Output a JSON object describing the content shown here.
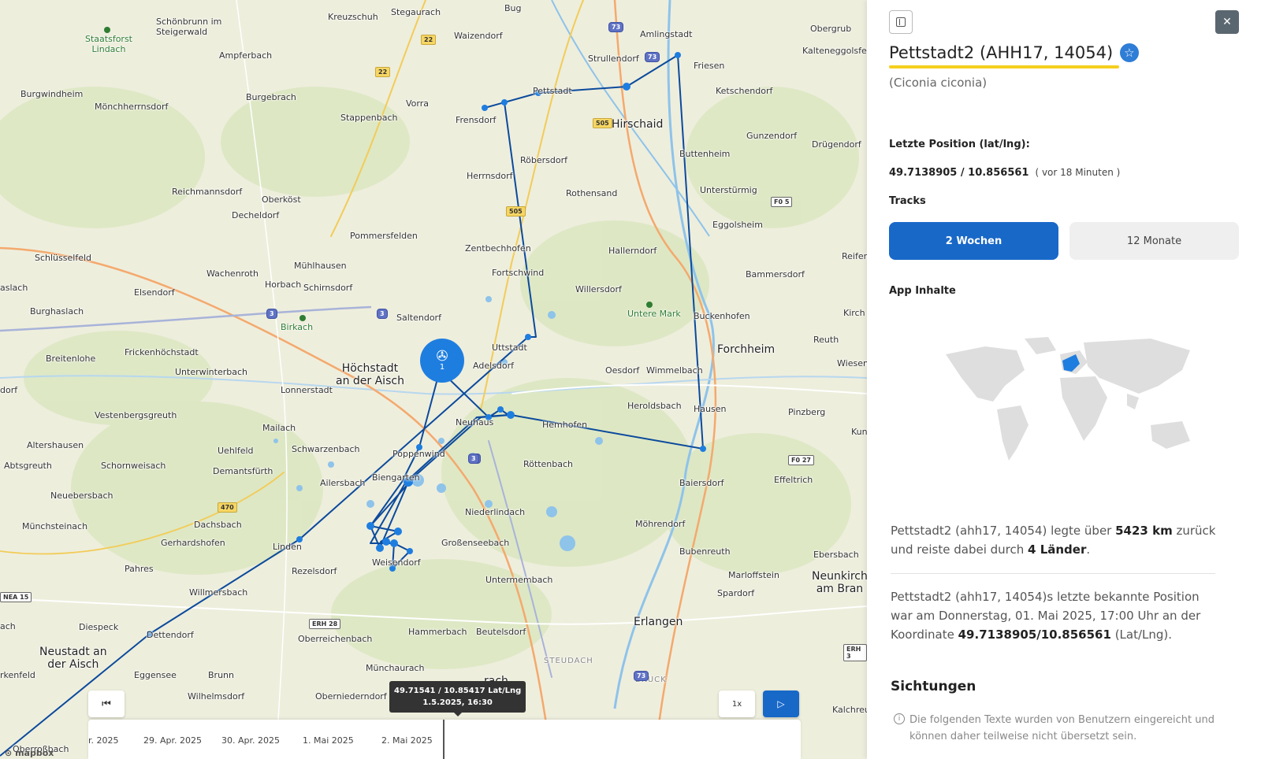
{
  "map": {
    "places": [
      {
        "name": "Schönbrunn im\nSteigerwald"
      },
      {
        "name": "Kreuzschuh"
      },
      {
        "name": "Stegaurach"
      },
      {
        "name": "Bug"
      },
      {
        "name": "Amlingstadt"
      },
      {
        "name": "Obergrub"
      },
      {
        "name": "Waizendorf"
      },
      {
        "name": "Ampferbach"
      },
      {
        "name": "Strullendorf"
      },
      {
        "name": "Kalteneggolsfeld"
      },
      {
        "name": "Friesen"
      },
      {
        "name": "Burgwindheim"
      },
      {
        "name": "Burgebrach"
      },
      {
        "name": "Pettstadt"
      },
      {
        "name": "Ketschendorf"
      },
      {
        "name": "Mönchherrnsdorf"
      },
      {
        "name": "Vorra"
      },
      {
        "name": "Stappenbach"
      },
      {
        "name": "Frensdorf"
      },
      {
        "name": "Gunzendorf"
      },
      {
        "name": "Drügendorf"
      },
      {
        "name": "Buttenheim"
      },
      {
        "name": "Röbersdorf"
      },
      {
        "name": "Herrnsdorf"
      },
      {
        "name": "Reichmannsdorf"
      },
      {
        "name": "Oberköst"
      },
      {
        "name": "Rothensand"
      },
      {
        "name": "Unterstürmig"
      },
      {
        "name": "Decheldorf"
      },
      {
        "name": "Eggolsheim"
      },
      {
        "name": "Pommersfelden"
      },
      {
        "name": "Zentbechhofen"
      },
      {
        "name": "Hallerndorf"
      },
      {
        "name": "Schlüsselfeld"
      },
      {
        "name": "Mühlhausen"
      },
      {
        "name": "Reifen"
      },
      {
        "name": "Wachenroth"
      },
      {
        "name": "Fortschwind"
      },
      {
        "name": "Bammersdorf"
      },
      {
        "name": "Horbach"
      },
      {
        "name": "Schirnsdorf"
      },
      {
        "name": "Willersdorf"
      },
      {
        "name": "Elsendorf"
      },
      {
        "name": "aslach"
      },
      {
        "name": "Burghaslach"
      },
      {
        "name": "Saltendorf"
      },
      {
        "name": "Buckenhofen"
      },
      {
        "name": "Kirch"
      },
      {
        "name": "Reuth"
      },
      {
        "name": "Uttstadt"
      },
      {
        "name": "Frickenhöchstadt"
      },
      {
        "name": "Breitenlohe"
      },
      {
        "name": "Adelsdorf"
      },
      {
        "name": "Wiesen"
      },
      {
        "name": "Unterwinterbach"
      },
      {
        "name": "Oesdorf"
      },
      {
        "name": "Wimmelbach"
      },
      {
        "name": "Lonnerstadt"
      },
      {
        "name": "dorf"
      },
      {
        "name": "Heroldsbach"
      },
      {
        "name": "Hausen"
      },
      {
        "name": "Vestenbergsgreuth"
      },
      {
        "name": "Neuhaus"
      },
      {
        "name": "Pinzberg"
      },
      {
        "name": "Hemhofen"
      },
      {
        "name": "Kun"
      },
      {
        "name": "Mailach"
      },
      {
        "name": "Altershausen"
      },
      {
        "name": "Schwarzenbach"
      },
      {
        "name": "Poppenwind"
      },
      {
        "name": "Uehlfeld"
      },
      {
        "name": "Abtsgreuth"
      },
      {
        "name": "Schornweisach"
      },
      {
        "name": "Röttenbach"
      },
      {
        "name": "Demantsfürth"
      },
      {
        "name": "Baiersdorf"
      },
      {
        "name": "Biengarten"
      },
      {
        "name": "Ailersbach"
      },
      {
        "name": "Effeltrich"
      },
      {
        "name": "Neuebersbach"
      },
      {
        "name": "Niederlindach"
      },
      {
        "name": "Münchsteinach"
      },
      {
        "name": "Dachsbach"
      },
      {
        "name": "Möhrendorf"
      },
      {
        "name": "Gerhardshofen"
      },
      {
        "name": "Linden"
      },
      {
        "name": "Großenseebach"
      },
      {
        "name": "Bubenreuth"
      },
      {
        "name": "Ebersbach"
      },
      {
        "name": "Pahres"
      },
      {
        "name": "Rezelsdorf"
      },
      {
        "name": "Weisendorf"
      },
      {
        "name": "Marloffstein"
      },
      {
        "name": "Untermembach"
      },
      {
        "name": "Willmersbach"
      },
      {
        "name": "Spardorf"
      },
      {
        "name": "ach"
      },
      {
        "name": "Diespeck"
      },
      {
        "name": "Hammerbach"
      },
      {
        "name": "Beutelsdorf"
      },
      {
        "name": "Dettendorf"
      },
      {
        "name": "Oberreichenbach"
      },
      {
        "name": "Eggensee"
      },
      {
        "name": "Brunn"
      },
      {
        "name": "Münchaurach"
      },
      {
        "name": "rkenfeld"
      },
      {
        "name": "Wilhelmsdorf"
      },
      {
        "name": "Oberniederndorf"
      },
      {
        "name": "Kalchreu"
      },
      {
        "name": "Oberroßbach"
      }
    ],
    "cities": [
      {
        "name": "Hirschaid"
      },
      {
        "name": "Forchheim"
      },
      {
        "name": "Höchstadt\nan der Aisch"
      },
      {
        "name": "Erlangen"
      },
      {
        "name": "Neustadt an\nder Aisch"
      },
      {
        "name": "Neunkirch\nam Bran"
      },
      {
        "name": "rach"
      }
    ],
    "forests": [
      {
        "name": "Staatsforst\nLindach"
      },
      {
        "name": "Birkach"
      },
      {
        "name": "Untere Mark"
      }
    ],
    "areas": [
      {
        "name": "STEUDACH"
      },
      {
        "name": "BRUCK"
      }
    ],
    "shields": [
      {
        "label": "22",
        "type": "b"
      },
      {
        "label": "22",
        "type": "b"
      },
      {
        "label": "73",
        "type": "a"
      },
      {
        "label": "73",
        "type": "a"
      },
      {
        "label": "505",
        "type": "b"
      },
      {
        "label": "505",
        "type": "b"
      },
      {
        "label": "F0 5",
        "type": "st"
      },
      {
        "label": "3",
        "type": "a"
      },
      {
        "label": "3",
        "type": "a"
      },
      {
        "label": "3",
        "type": "a"
      },
      {
        "label": "3",
        "type": "a"
      },
      {
        "label": "470",
        "type": "b"
      },
      {
        "label": "F0 27",
        "type": "st"
      },
      {
        "label": "NEA 15",
        "type": "st"
      },
      {
        "label": "ERH 28",
        "type": "st"
      },
      {
        "label": "73",
        "type": "a"
      },
      {
        "label": "ERH 3",
        "type": "st"
      }
    ],
    "current_marker_count": "1",
    "tooltip": {
      "line1": "49.71541 / 10.85417 Lat/Lng",
      "line2": "1.5.2025, 16:30"
    },
    "speed_label": "1x",
    "timeline_ticks": [
      "r. 2025",
      "29. Apr. 2025",
      "30. Apr. 2025",
      "1. Mai 2025",
      "2. Mai 2025"
    ],
    "track_color": "#0b4a9c",
    "marker_color": "#1e7ee0",
    "attribution": "mapbox"
  },
  "panel": {
    "title": "Pettstadt2 (AHH17, 14054)",
    "species": "(Ciconia ciconia)",
    "position_label": "Letzte Position (lat/lng):",
    "coords": "49.7138905 / 10.856561",
    "ago": "( vor 18 Minuten )",
    "tracks_label": "Tracks",
    "tabs": [
      "2 Wochen",
      "12 Monate"
    ],
    "app_label": "App Inhalte",
    "para1": {
      "pre": "Pettstadt2 (ahh17, 14054) legte über ",
      "dist": "5423 km",
      "mid": " zurück und reiste dabei durch ",
      "countries": "4 Länder",
      "post": "."
    },
    "para2": {
      "pre": "Pettstadt2 (ahh17, 14054)s letzte bekannte Position war am Donnerstag, 01. Mai 2025, 17:00 Uhr an der Koordinate ",
      "coord": "49.7138905/10.856561",
      "post": " (Lat/Lng)."
    },
    "sightings_label": "Sichtungen",
    "disclaimer": "Die folgenden Texte wurden von Benutzern eingereicht und können daher teilweise nicht übersetzt sein.",
    "accent": "#1868c8",
    "highlight": "#f5cf1f"
  }
}
